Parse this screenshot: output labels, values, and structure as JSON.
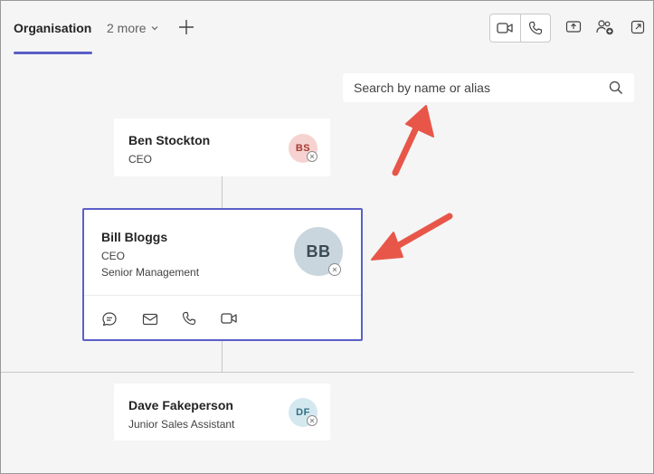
{
  "tabs": {
    "active": "Organisation",
    "more": "2 more"
  },
  "search": {
    "placeholder": "Search by name or alias"
  },
  "manager": {
    "name": "Ben Stockton",
    "title": "CEO",
    "initials": "BS"
  },
  "selected": {
    "name": "Bill Bloggs",
    "title": "CEO",
    "department": "Senior Management",
    "initials": "BB"
  },
  "report": {
    "name": "Dave Fakeperson",
    "title": "Junior Sales Assistant",
    "initials": "DF"
  },
  "colors": {
    "accent": "#5b5fc7",
    "arrow": "#e8564a",
    "avatar_bs_bg": "#f6d3d0",
    "avatar_bs_fg": "#a33a2e",
    "avatar_bb_bg": "#c9d6dd",
    "avatar_bb_fg": "#3a4a55",
    "avatar_df_bg": "#d4e8ef",
    "avatar_df_fg": "#2f6f85"
  }
}
